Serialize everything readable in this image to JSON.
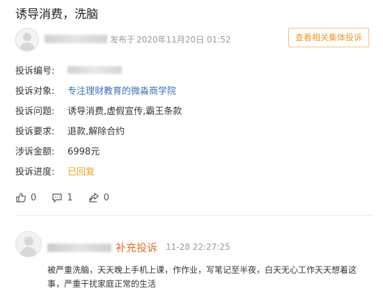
{
  "title": "诱导消费，洗脑",
  "header": {
    "published_prefix": "发布于",
    "published_time": "2020年11月20日 01:52",
    "collective_button": "查看相关集体投诉"
  },
  "fields": [
    {
      "label": "投诉编号:",
      "value": ""
    },
    {
      "label": "投诉对象:",
      "value": "专注理财教育的微淼商学院"
    },
    {
      "label": "投诉问题:",
      "value": "诱导消费,虚假宣传,霸王条款"
    },
    {
      "label": "投诉要求:",
      "value": "退款,解除合约"
    },
    {
      "label": "涉诉金额:",
      "value": "6998元"
    },
    {
      "label": "投诉进度:",
      "value": "已回复"
    }
  ],
  "actions": {
    "like_count": "0",
    "comment_count": "1",
    "share_count": "0"
  },
  "reply": {
    "type_label": "补充投诉",
    "time": "11-28 22:27:25",
    "text": "被严重洗脑，天天晚上手机上课，作作业，写笔记至半夜，白天无心工作天天想着这事，严重干扰家庭正常的生活"
  },
  "colors": {
    "accent_orange": "#f0a028",
    "link_blue": "#3a6fb5",
    "supplement_orange": "#e07030"
  }
}
